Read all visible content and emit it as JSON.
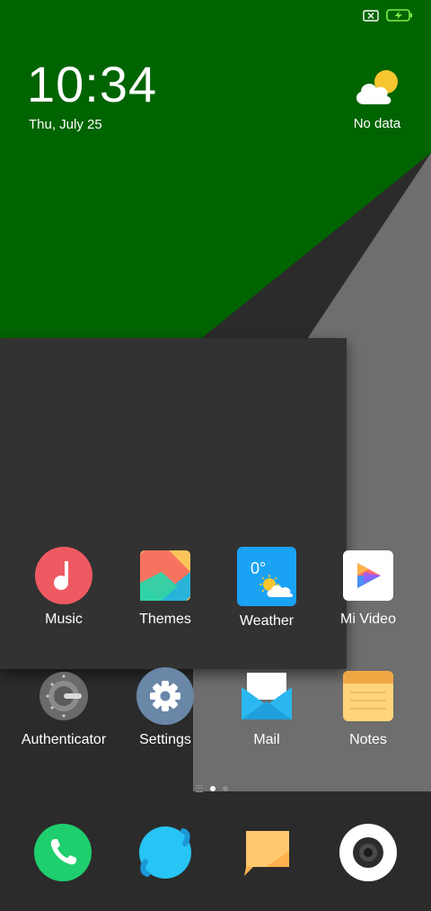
{
  "status": {
    "battery_icon": "battery-charging-icon",
    "sim_icon": "no-sim-icon"
  },
  "clock": {
    "time": "10:34",
    "date": "Thu, July 25"
  },
  "weather_widget": {
    "text": "No data",
    "icon": "partly-cloudy-icon"
  },
  "weather_app_icon": {
    "temp": "0°"
  },
  "apps": [
    {
      "label": "Music",
      "icon": "music-icon"
    },
    {
      "label": "Themes",
      "icon": "themes-icon"
    },
    {
      "label": "Weather",
      "icon": "weather-icon"
    },
    {
      "label": "Mi Video",
      "icon": "mi-video-icon"
    },
    {
      "label": "Authenticator",
      "icon": "authenticator-icon"
    },
    {
      "label": "Settings",
      "icon": "settings-gear-icon"
    },
    {
      "label": "Mail",
      "icon": "mail-icon"
    },
    {
      "label": "Notes",
      "icon": "notes-icon"
    }
  ],
  "dock": [
    {
      "icon": "phone-icon"
    },
    {
      "icon": "browser-icon"
    },
    {
      "icon": "messages-icon"
    },
    {
      "icon": "camera-icon"
    }
  ],
  "pages": {
    "count": 2,
    "active": 1
  },
  "colors": {
    "green": "#006400",
    "dark": "#2b2b2b",
    "gray": "#6e6e6e",
    "panel": "#333333"
  }
}
